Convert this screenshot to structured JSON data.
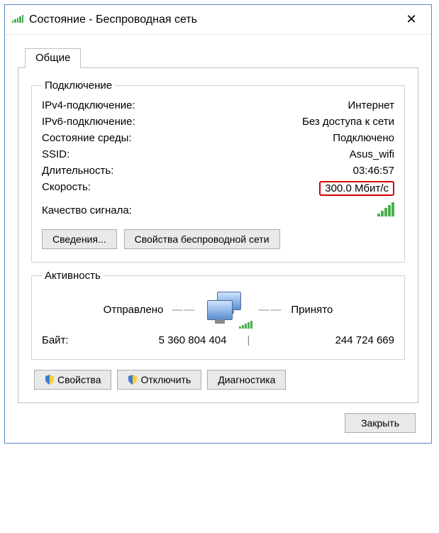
{
  "titlebar": {
    "title": "Состояние - Беспроводная сеть"
  },
  "tab": {
    "general": "Общие"
  },
  "connection": {
    "legend": "Подключение",
    "ipv4_label": "IPv4-подключение:",
    "ipv4_value": "Интернет",
    "ipv6_label": "IPv6-подключение:",
    "ipv6_value": "Без доступа к сети",
    "media_label": "Состояние среды:",
    "media_value": "Подключено",
    "ssid_label": "SSID:",
    "ssid_value": "Asus_wifi",
    "duration_label": "Длительность:",
    "duration_value": "03:46:57",
    "speed_label": "Скорость:",
    "speed_value": "300.0 Мбит/с",
    "signal_label": "Качество сигнала:"
  },
  "buttons": {
    "details": "Сведения...",
    "wireless_props": "Свойства беспроводной сети",
    "properties": "Свойства",
    "disable": "Отключить",
    "diagnose": "Диагностика",
    "close": "Закрыть"
  },
  "activity": {
    "legend": "Активность",
    "sent_label": "Отправлено",
    "recv_label": "Принято",
    "bytes_label": "Байт:",
    "sent_value": "5 360 804 404",
    "recv_value": "244 724 669"
  }
}
